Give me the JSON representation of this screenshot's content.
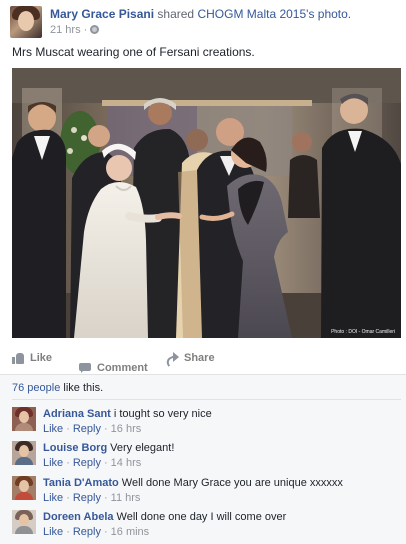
{
  "post": {
    "author": "Mary Grace Pisani",
    "action_text": "shared",
    "shared_page": "CHOGM Malta 2015's photo.",
    "timestamp": "21 hrs",
    "separator": "·",
    "privacy_icon": "globe-icon",
    "caption": "Mrs Muscat wearing one of Fersani creations.",
    "photo_credit": "Photo : DOI - Omar Camilleri"
  },
  "actions": {
    "like": "Like",
    "comment": "Comment",
    "share": "Share"
  },
  "likes": {
    "count": "76 people",
    "suffix": "like this."
  },
  "comments": [
    {
      "name": "Adriana Sant",
      "text": "i tought so very nice",
      "like": "Like",
      "reply": "Reply",
      "time": "16 hrs"
    },
    {
      "name": "Louise Borg",
      "text": "Very elegant!",
      "like": "Like",
      "reply": "Reply",
      "time": "14 hrs"
    },
    {
      "name": "Tania D'Amato",
      "text": "Well done Mary Grace you are unique xxxxxx",
      "like": "Like",
      "reply": "Reply",
      "time": "11 hrs"
    },
    {
      "name": "Doreen Abela",
      "text": "Well done one day I will come over",
      "like": "Like",
      "reply": "Reply",
      "time": "16 mins"
    }
  ],
  "colors": {
    "link": "#365899",
    "meta": "#90949c",
    "text": "#1d2129",
    "comment_bg": "#f6f7f9"
  }
}
